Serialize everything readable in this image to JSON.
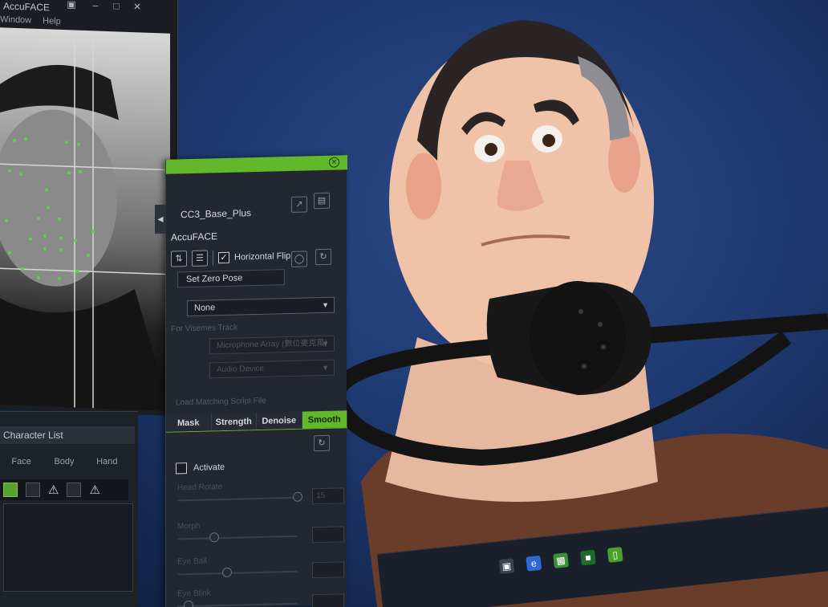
{
  "webcam_window": {
    "title": "AccuFACE",
    "menu": [
      "Window",
      "Help"
    ]
  },
  "accuface_panel": {
    "avatar_name": "CC3_Base_Plus",
    "title": "AccuFACE",
    "horizontal_flip_label": "Horizontal Flip",
    "horizontal_flip_checked": true,
    "zero_pose_label": "Set Zero Pose",
    "mic_selection": "None",
    "visemes_label": "For Visemes Track",
    "mic_array": "Microphone Array (數位麥克風)",
    "audio_device": "Audio Device",
    "load_script_label": "Load Matching Script File",
    "tabs": [
      "Mask",
      "Strength",
      "Denoise",
      "Smooth"
    ],
    "active_tab": "Smooth",
    "activate_label": "Activate",
    "sliders": [
      {
        "label": "Head Rotate",
        "value": "15"
      },
      {
        "label": "Morph",
        "value": ""
      },
      {
        "label": "Eye Ball",
        "value": ""
      },
      {
        "label": "Eye Blink",
        "value": ""
      }
    ]
  },
  "character_list": {
    "header": "Character List",
    "columns": [
      "Face",
      "Body",
      "Hand"
    ]
  },
  "icons": {
    "close": "close-icon",
    "collapse": "collapse-arrow-icon",
    "warning": "warning-icon",
    "reset": "reset-icon"
  },
  "colors": {
    "accent_green": "#62b82a",
    "viewport_blue": "#1f3a72",
    "panel_dark": "#232730"
  }
}
